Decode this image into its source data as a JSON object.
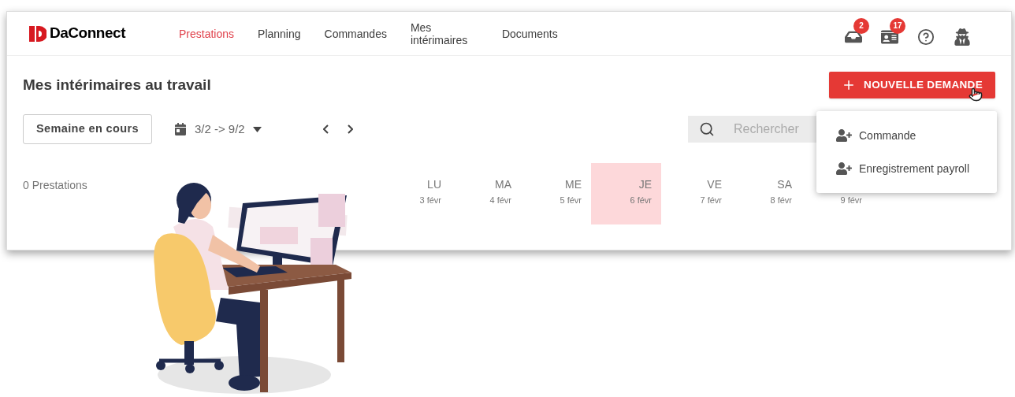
{
  "brand": "DaConnect",
  "nav": [
    {
      "label": "Prestations",
      "selected": true
    },
    {
      "label": "Planning",
      "selected": false
    },
    {
      "label": "Commandes",
      "selected": false
    },
    {
      "label": "Mes intérimaires",
      "selected": false
    },
    {
      "label": "Documents",
      "selected": false
    }
  ],
  "header_icons": [
    {
      "kind": "inbox",
      "badge": "2"
    },
    {
      "kind": "card",
      "badge": "17"
    },
    {
      "kind": "help"
    },
    {
      "kind": "user"
    }
  ],
  "title": "Mes intérimaires au travail",
  "new_button": "NOUVELLE DEMANDE",
  "week_button": "Semaine en cours",
  "date_range": "3/2 -> 9/2",
  "search": {
    "placeholder": "Rechercher"
  },
  "menu": {
    "items": [
      "Commande",
      "Enregistrement payroll"
    ]
  },
  "count": "0 Prestations",
  "days": [
    {
      "label": "LU",
      "date": "3 févr",
      "selected": false
    },
    {
      "label": "MA",
      "date": "4 févr",
      "selected": false
    },
    {
      "label": "ME",
      "date": "5 févr",
      "selected": false
    },
    {
      "label": "JE",
      "date": "6 févr",
      "selected": true
    },
    {
      "label": "VE",
      "date": "7 févr",
      "selected": false
    },
    {
      "label": "SA",
      "date": "8 févr",
      "selected": false
    },
    {
      "date": "9 févr",
      "selected": false
    }
  ]
}
